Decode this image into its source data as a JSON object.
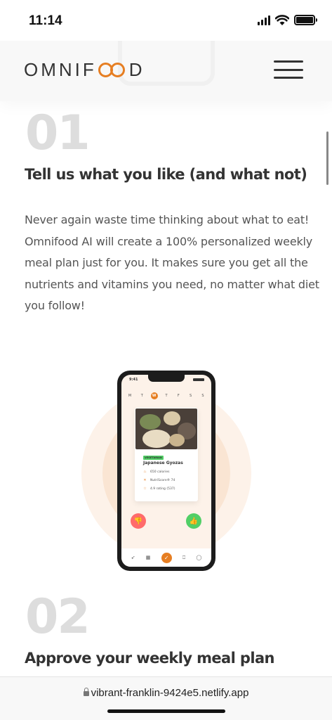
{
  "status_bar": {
    "time": "11:14"
  },
  "header": {
    "logo_left": "OMNIF",
    "logo_right": "D"
  },
  "steps": [
    {
      "number": "01",
      "title": "Tell us what you like (and what not)",
      "text": "Never again waste time thinking about what to eat! Omnifood AI will create a 100% personalized weekly meal plan just for you. It makes sure you get all the nutrients and vitamins you need, no matter what diet you follow!"
    },
    {
      "number": "02",
      "title": "Approve your weekly meal plan"
    }
  ],
  "phone_app": {
    "time": "9:41",
    "weekdays": [
      "M",
      "T",
      "W",
      "T",
      "F",
      "S",
      "S"
    ],
    "active_day": 2,
    "meal": {
      "tag": "VEGETARIAN",
      "name": "Japanese Gyozas",
      "calories": "650 calories",
      "nutriscore": "NutriScore® 74",
      "rating": "4.9 rating (537)"
    }
  },
  "browser": {
    "url": "vibrant-franklin-9424e5.netlify.app"
  },
  "colors": {
    "accent": "#e67e22",
    "like": "#51cf66",
    "dislike": "#ff6b6b"
  }
}
